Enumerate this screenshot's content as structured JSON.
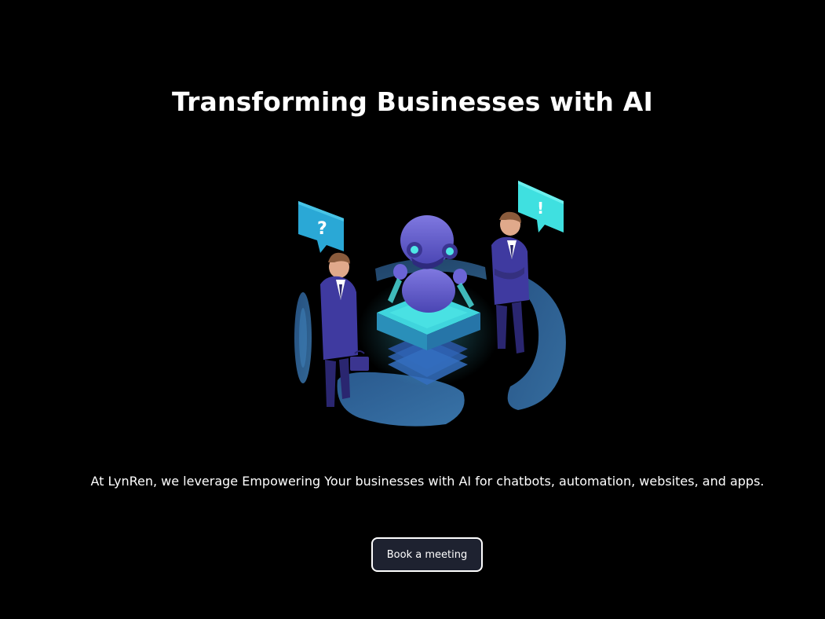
{
  "hero": {
    "title": "Transforming Businesses with AI",
    "tagline": "At LynRen, we leverage Empowering Your businesses with AI for chatbots, automation, websites, and apps.",
    "cta_label": "Book a meeting"
  },
  "illustration": {
    "left_bubble_symbol": "?",
    "right_bubble_symbol": "!",
    "icon_names": [
      "question-bubble-icon",
      "exclamation-bubble-icon",
      "robot-icon",
      "businessman-icon"
    ]
  },
  "colors": {
    "background": "#000000",
    "text": "#ffffff",
    "button_bg": "#1e2230",
    "accent_cyan": "#3fe0e0",
    "accent_blue": "#2d6fa8",
    "accent_purple": "#5a4fc0"
  }
}
